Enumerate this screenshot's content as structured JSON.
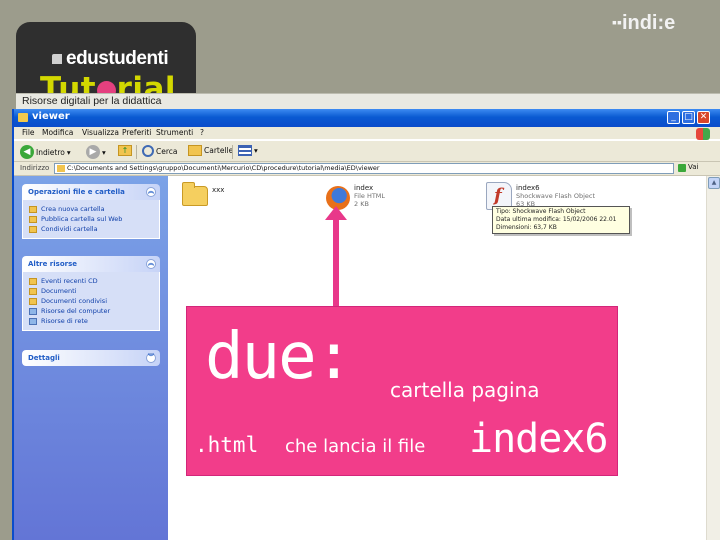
{
  "branding": {
    "logo_text": "edustudenti",
    "title_pre": "Tut",
    "title_post": "rial",
    "tagline": "Risorse digitali per la didattica",
    "publisher_a": "indi",
    "publisher_b": "e",
    "publisher_mark": "▪▪"
  },
  "window": {
    "title": "viewer",
    "controls": {
      "minimize": "_",
      "maximize": "□",
      "close": "✕"
    }
  },
  "menu": [
    "File",
    "Modifica",
    "Visualizza",
    "Preferiti",
    "Strumenti",
    "?"
  ],
  "toolbar": {
    "back_label": "Indietro",
    "search_label": "Cerca",
    "folders_label": "Cartelle"
  },
  "address": {
    "label": "Indirizzo",
    "value": "C:\\Documents and Settings\\gruppo\\Documenti\\Mercurio\\CD\\procedure\\tutorial\\media\\ED\\viewer",
    "go_label": "Vai"
  },
  "taskpane": {
    "panels": [
      {
        "title": "Operazioni file e cartella",
        "items": [
          "Crea nuova cartella",
          "Pubblica cartella sul Web",
          "Condividi cartella"
        ]
      },
      {
        "title": "Altre risorse",
        "items": [
          "Eventi recenti CD",
          "Documenti",
          "Documenti condivisi",
          "Risorse del computer",
          "Risorse di rete"
        ]
      },
      {
        "title": "Dettagli",
        "items": []
      }
    ]
  },
  "files": [
    {
      "name": "xxx",
      "type": "",
      "size": ""
    },
    {
      "name": "index",
      "type": "File HTML",
      "size": "2 KB"
    },
    {
      "name": "index6",
      "type": "Shockwave Flash Object",
      "size": "63 KB"
    }
  ],
  "tooltip": [
    "Tipo: Shockwave Flash Object",
    "Data ultima modifica: 15/02/2006 22.01",
    "Dimensioni: 63,7 KB"
  ],
  "callout": {
    "big": "due:",
    "small": "cartella pagina",
    "line2_start": ".html",
    "line2_mid": "che lancia il file",
    "line2_end": "index6"
  },
  "colors": {
    "accent": "#f23d8a",
    "title_bar": "#0a4ccb",
    "brand_yellow": "#d3d800"
  }
}
